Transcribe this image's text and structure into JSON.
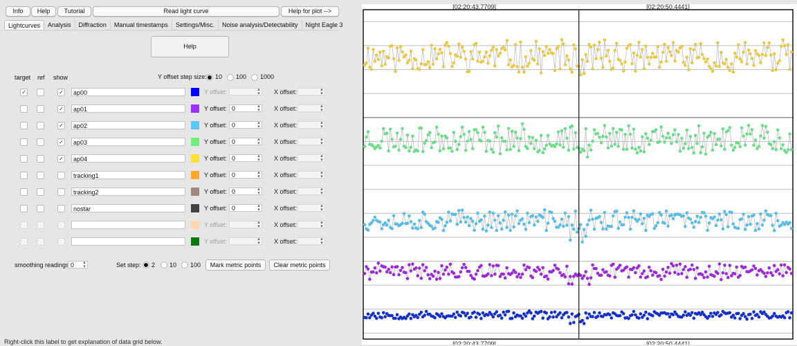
{
  "toolbar": {
    "info": "Info",
    "help": "Help",
    "tutorial": "Tutorial",
    "read": "Read light curve",
    "help_plot": "Help for plot -->"
  },
  "tabs": [
    "Lightcurves",
    "Analysis",
    "Diffraction",
    "Manual timestamps",
    "Settings/Misc.",
    "Noise analysis/Detectability",
    "Night Eagle 3"
  ],
  "help_button": "Help",
  "headers": {
    "target": "target",
    "ref": "ref",
    "show": "show"
  },
  "y_step": {
    "label": "Y offset step size:",
    "options": [
      "10",
      "100",
      "1000"
    ],
    "selected": "10"
  },
  "apertures": [
    {
      "target": true,
      "ref": false,
      "show": true,
      "name": "ap00",
      "color": "#0000ff",
      "yoff": "",
      "xoff": "",
      "y_enabled": false
    },
    {
      "target": false,
      "ref": false,
      "show": true,
      "name": "ap01",
      "color": "#9b30ff",
      "yoff": "0",
      "xoff": "",
      "y_enabled": true
    },
    {
      "target": false,
      "ref": false,
      "show": true,
      "name": "ap02",
      "color": "#5bc6f1",
      "yoff": "0",
      "xoff": "",
      "y_enabled": true
    },
    {
      "target": false,
      "ref": false,
      "show": true,
      "name": "ap03",
      "color": "#6ff07a",
      "yoff": "0",
      "xoff": "",
      "y_enabled": true
    },
    {
      "target": false,
      "ref": false,
      "show": true,
      "name": "ap04",
      "color": "#ffe135",
      "yoff": "0",
      "xoff": "",
      "y_enabled": true
    },
    {
      "target": false,
      "ref": false,
      "show": false,
      "name": "tracking1",
      "color": "#ffa726",
      "yoff": "0",
      "xoff": "",
      "y_enabled": true
    },
    {
      "target": false,
      "ref": false,
      "show": false,
      "name": "tracking2",
      "color": "#a1887f",
      "yoff": "0",
      "xoff": "",
      "y_enabled": true
    },
    {
      "target": false,
      "ref": false,
      "show": false,
      "name": "nostar",
      "color": "#424242",
      "yoff": "0",
      "xoff": "",
      "y_enabled": true
    },
    {
      "target": false,
      "ref": false,
      "show": false,
      "name": "",
      "color": "#ffd8b0",
      "yoff": "",
      "xoff": "",
      "y_enabled": false
    },
    {
      "target": false,
      "ref": false,
      "show": false,
      "name": "",
      "color": "#0d7a0d",
      "yoff": "",
      "xoff": "",
      "y_enabled": false
    }
  ],
  "labels": {
    "y_offset": "Y offset:",
    "x_offset": "X offset:"
  },
  "smoothing": {
    "label": "smoothing readings",
    "value": "0"
  },
  "set_step": {
    "label": "Set step:",
    "options": [
      "2",
      "10",
      "100"
    ],
    "selected": "2"
  },
  "mark_metric": "Mark metric points",
  "clear_metric": "Clear metric points",
  "bottom_text": "Right-click this label to get explanation of data grid below.",
  "chart_data": {
    "type": "scatter",
    "title": "",
    "xlabel": "",
    "ylabel": "",
    "ylim": [
      150,
      2900
    ],
    "yticks": [
      200,
      400,
      600,
      800,
      1000,
      1200,
      1400,
      1600,
      1800,
      2000,
      2200,
      2400,
      2600,
      2800
    ],
    "grid": true,
    "n_points": 250,
    "cursor_index": 125,
    "top_time_labels": [
      "[02:20:43.7709]",
      "[02:20:50.4441]"
    ],
    "bottom_time_labels": [
      "[02:20:43.7709]",
      "[02:20:50.4441]"
    ],
    "series": [
      {
        "name": "ap04",
        "color": "#e8c94a",
        "mean": 2510,
        "spread": 120,
        "seed": 11
      },
      {
        "name": "ap03",
        "color": "#6fdc8c",
        "mean": 1820,
        "spread": 110,
        "seed": 23
      },
      {
        "name": "ap02",
        "color": "#5bbde4",
        "mean": 1140,
        "spread": 80,
        "seed": 37
      },
      {
        "name": "ap01",
        "color": "#9a2bd6",
        "mean": 715,
        "spread": 60,
        "seed": 41
      },
      {
        "name": "ap00",
        "color": "#1530c8",
        "mean": 350,
        "spread": 30,
        "seed": 53
      }
    ]
  }
}
